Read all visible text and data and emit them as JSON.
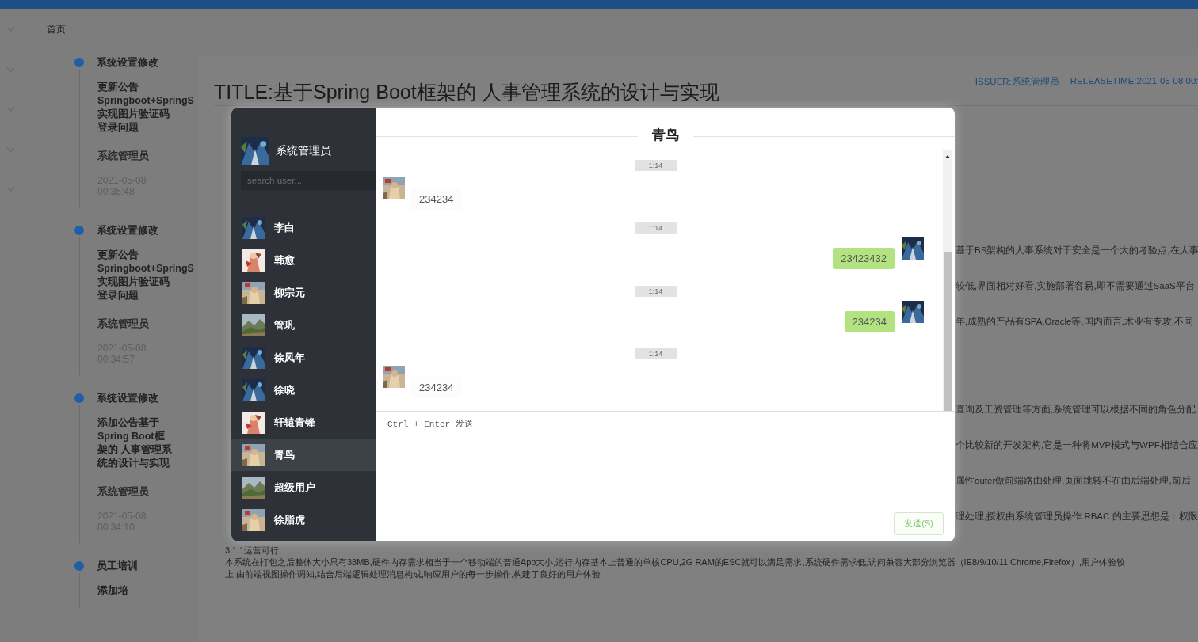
{
  "top_bar": {
    "kind": "bar"
  },
  "nav": [
    {
      "label": "首页",
      "expanded": false
    },
    {
      "expanded": false
    },
    {
      "expanded": false
    },
    {
      "expanded": false
    },
    {
      "expanded": false
    }
  ],
  "timeline": [
    {
      "title": "系统设置修改",
      "content": "更新公告Springboot+SpringS实现图片验证码登录问题",
      "author": "系统管理员",
      "time": "2021-05-08 00:35:48"
    },
    {
      "title": "系统设置修改",
      "content": "更新公告Springboot+SpringS实现图片验证码登录问题",
      "author": "系统管理员",
      "time": "2021-05-08 00:34:57"
    },
    {
      "title": "系统设置修改",
      "content": "添加公告基于Spring Boot框架的 人事管理系统的设计与实现",
      "author": "系统管理员",
      "time": "2021-05-08 00:34:10"
    },
    {
      "title": "员工培训",
      "content": "添加培"
    }
  ],
  "article": {
    "title": "TITLE:基于Spring Boot框架的 人事管理系统的设计与实现",
    "issuer": "ISSUER:系统管理员",
    "release_time": "RELEASETIME:2021-05-08 00:",
    "fragments": [
      "基于BS架构的人事系统对于安全是一个大的考验点,在人事",
      "较低,界面相对好看,实施部署容易,即不需要通过SaaS平台",
      "年,成熟的产品有SPA,Oracle等,国内而言,术业有专攻,不同",
      "查询及工资管理等方面,系统管理可以根据不同的角色分配",
      "个比较新的开发架构,它是一种将MVP模式与WPF相结合应",
      "属性outer做前端路由处理,页面跳转不在由后端处理,前后",
      "理处理,授权由系统管理员操作.RBAC 的主要思想是：权限"
    ],
    "heading": "3.1.1运营可行",
    "paragraphs": [
      "本系统在打包之后整体大小只有38MB,硬件内存需求相当于一个移动端的普通App大小,运行内存基本上普通的单核CPU,2G RAM的ESC就可以满足需求,系统硬件需求低,访问兼容大部分浏览器（IE8/9/10/11,Chrome,Firefox）,用户体验较",
      "上,由前端视图操作调知,结合后端逻辑处理消息构成,响应用户的每一步操作,构建了良好的用户体验"
    ]
  },
  "chat": {
    "me": {
      "name": "系统管理员"
    },
    "search": {
      "placeholder": "search user..."
    },
    "users": [
      {
        "name": "李白",
        "selected": false
      },
      {
        "name": "韩愈",
        "selected": false
      },
      {
        "name": "柳宗元",
        "selected": false
      },
      {
        "name": "管巩",
        "selected": false
      },
      {
        "name": "徐凤年",
        "selected": false
      },
      {
        "name": "徐晓",
        "selected": false
      },
      {
        "name": "轩辕青锋",
        "selected": false
      },
      {
        "name": "青鸟",
        "selected": true
      },
      {
        "name": "超级用户",
        "selected": false
      },
      {
        "name": "徐脂虎",
        "selected": false
      }
    ],
    "title": "青鸟",
    "messages": [
      {
        "time": "1:14",
        "kind": "in",
        "text": "234234"
      },
      {
        "time": "1:14",
        "kind": "out",
        "text": "23423432"
      },
      {
        "time": "1:14",
        "kind": "out",
        "text": "234234"
      },
      {
        "time": "1:14",
        "kind": "in",
        "text": "234234"
      }
    ],
    "input": {
      "placeholder": "Ctrl + Enter 发送"
    },
    "send_button": "发送(S)"
  }
}
